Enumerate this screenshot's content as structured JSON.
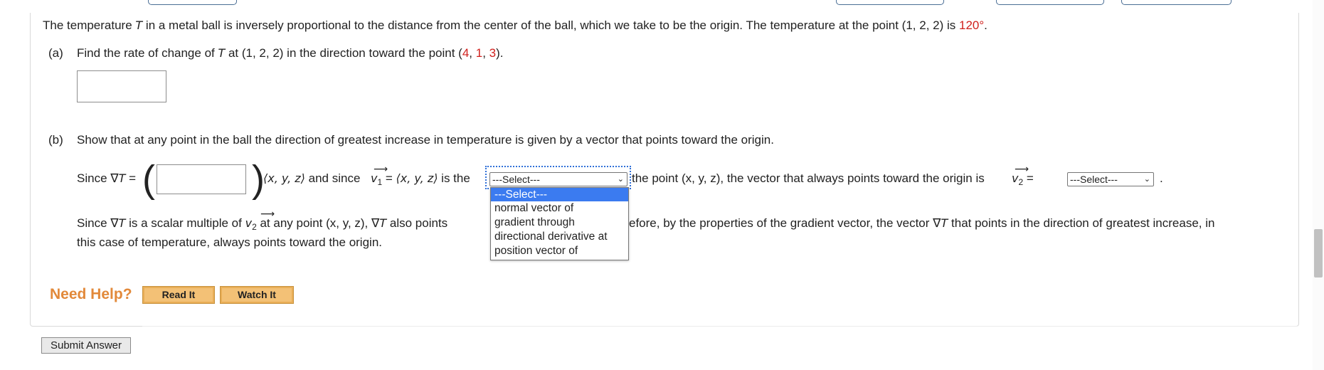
{
  "problem": {
    "intro_text": "The temperature ",
    "intro_T": "T",
    "intro_rest": " in a metal ball is inversely proportional to the distance from the center of the ball, which we take to be the origin. The temperature at the point (1, 2, 2) is ",
    "intro_value": "120°",
    "intro_end": "."
  },
  "part_a": {
    "label": "(a)",
    "text_before": "Find the rate of change of ",
    "T": "T",
    "text_mid": " at (1, 2, 2) in the direction toward the point (",
    "p1": "4",
    "comma1": ", ",
    "p2": "1",
    "comma2": ", ",
    "p3": "3",
    "text_end": ")."
  },
  "part_b": {
    "label": "(b)",
    "text": "Show that at any point in the ball the direction of greatest increase in temperature is given by a vector that points toward the origin.",
    "since_label": "Since ∇",
    "since_T": "T",
    "since_eq": " =",
    "xyz": "⟨x, y, z⟩",
    "and_since": " and since ",
    "v": "v",
    "v1_sub": "1",
    "v1_eq": " = ",
    "v1_val": "⟨x, y, z⟩",
    "is_the": " is the",
    "select1_value": "---Select---",
    "after_select": "the point (x, y, z), the vector that always points toward the origin is ",
    "v2_sub": "2",
    "v2_eq": " = ",
    "select2_value": "---Select---",
    "end_period": ".",
    "line2_start": "Since ∇",
    "line2_T": "T",
    "line2_mid": " is a scalar multiple of ",
    "line2_v2_sub": "2",
    "line2_after": " at any point (x, y, z), ∇",
    "line2_T2": "T",
    "line2_also": " also points",
    "line2_right": "efore, by the properties of the gradient vector, the vector ∇",
    "line2_T3": "T",
    "line2_right_end": " that points in the direction of greatest increase, in",
    "line3": "this case of temperature, always points toward the origin."
  },
  "dropdown_options": [
    "---Select---",
    "normal vector of",
    "gradient through",
    "directional derivative at",
    "position vector of"
  ],
  "help": {
    "label": "Need Help?",
    "read_it": "Read It",
    "watch_it": "Watch It"
  },
  "submit_label": "Submit Answer",
  "colors": {
    "accent_red": "#d0201d",
    "help_orange": "#e2893a",
    "select_highlight": "#3b7bf0"
  }
}
